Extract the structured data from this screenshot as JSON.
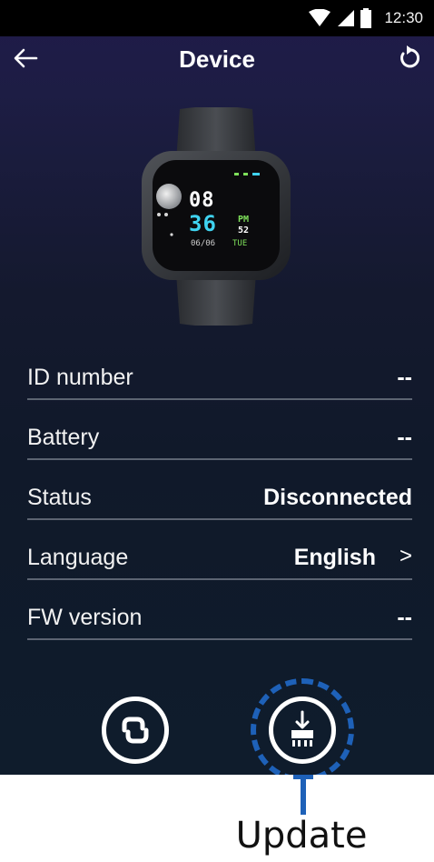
{
  "status_bar": {
    "time": "12:30"
  },
  "header": {
    "title": "Device"
  },
  "watch": {
    "hour": "08",
    "minute": "36",
    "ampm": "PM",
    "seconds": "52",
    "date": "06/06",
    "weekday": "TUE"
  },
  "info": {
    "rows": [
      {
        "label": "ID number",
        "value": "--"
      },
      {
        "label": "Battery",
        "value": "--"
      },
      {
        "label": "Status",
        "value": "Disconnected"
      },
      {
        "label": "Language",
        "value": "English"
      },
      {
        "label": "FW version",
        "value": "--"
      }
    ],
    "language_chevron": ">"
  },
  "callout": {
    "label": "Update"
  },
  "colors": {
    "highlight": "#1e61b8",
    "divider": "#5c6472",
    "watch_cyan": "#3fd3f0",
    "watch_green": "#7ee05a"
  }
}
